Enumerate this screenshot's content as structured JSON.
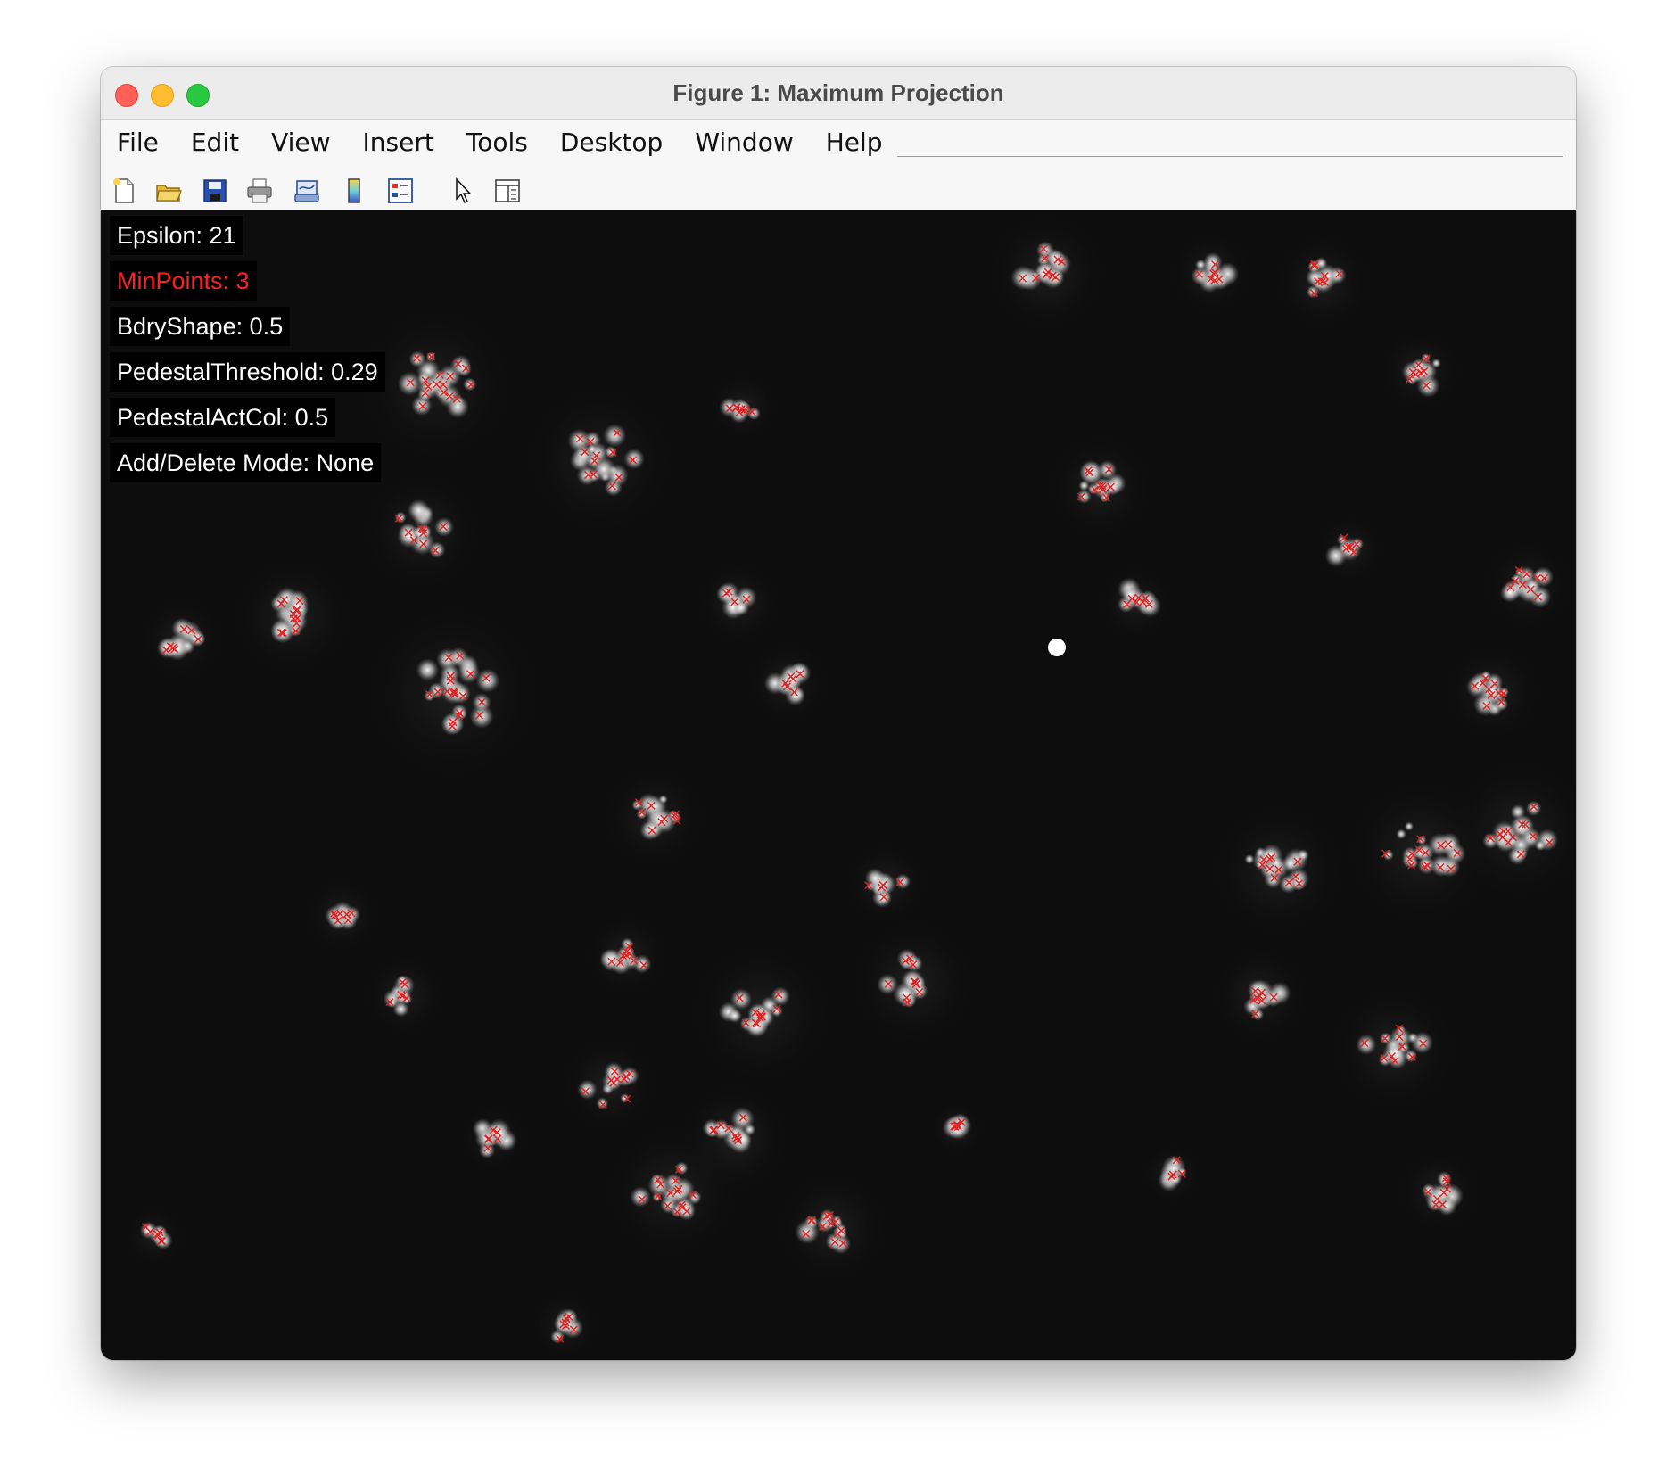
{
  "window": {
    "title": "Figure 1: Maximum Projection"
  },
  "menu": {
    "items": [
      "File",
      "Edit",
      "View",
      "Insert",
      "Tools",
      "Desktop",
      "Window",
      "Help"
    ]
  },
  "toolbar": {
    "icons": [
      "new-figure-icon",
      "open-file-icon",
      "save-icon",
      "print-icon",
      "link-plot-icon",
      "colorbar-icon",
      "legend-icon",
      "edit-plot-arrow-icon",
      "property-editor-icon"
    ]
  },
  "params": {
    "epsilon": "Epsilon: 21",
    "minpoints": "MinPoints: 3",
    "bdryshape": "BdryShape: 0.5",
    "pedestal_threshold": "PedestalThreshold: 0.29",
    "pedestal_actcol": "PedestalActCol: 0.5",
    "mode": "Add/Delete Mode: None"
  },
  "colors": {
    "highlight_param": "#ff2020",
    "marker": "#e02020",
    "background": "#0d0d0d"
  }
}
